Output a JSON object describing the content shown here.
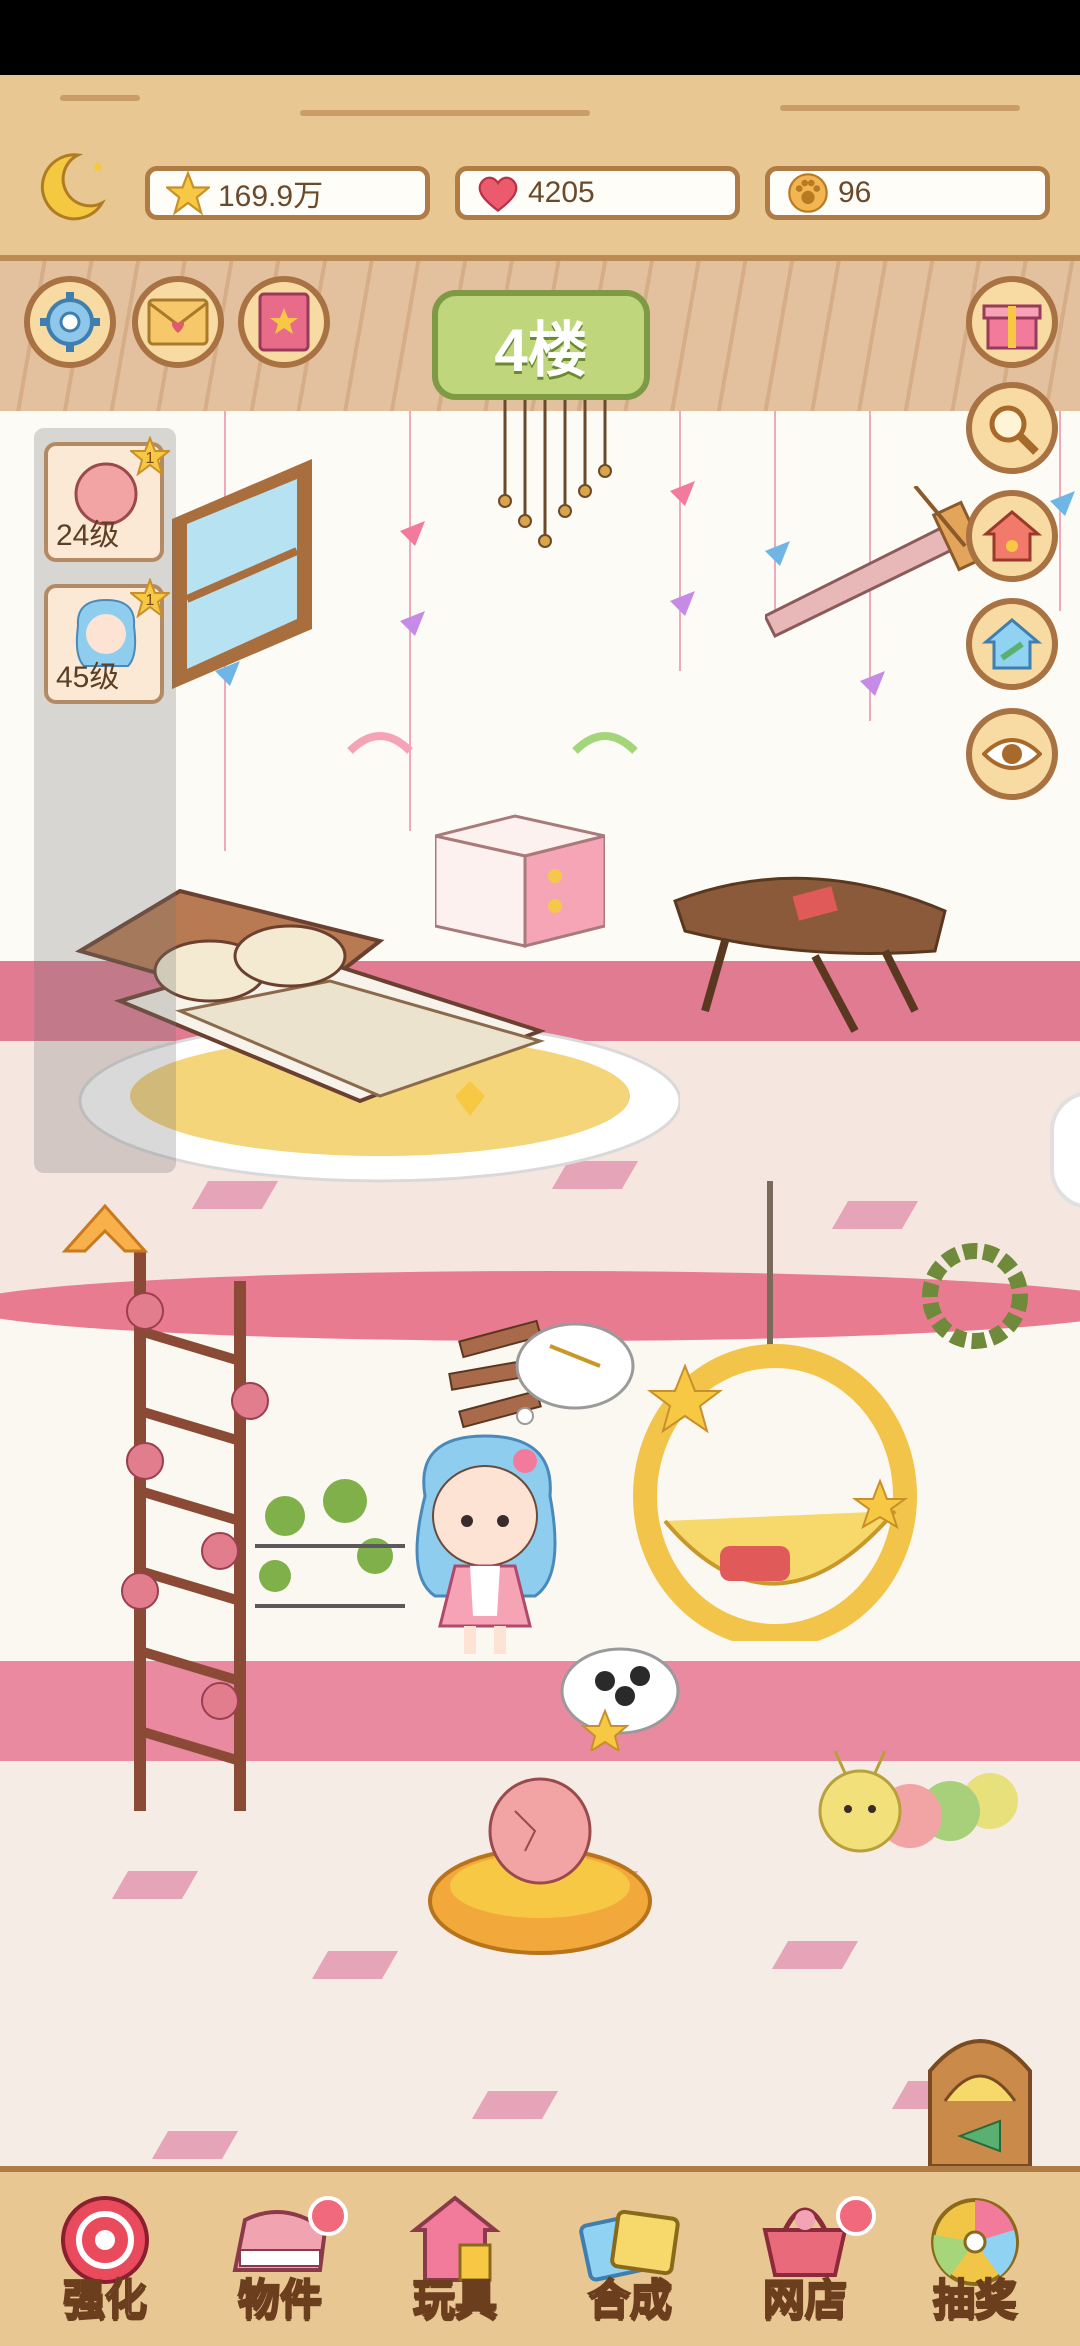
{
  "resources": [
    {
      "icon": "star-icon",
      "value": "169.9万"
    },
    {
      "icon": "heart-icon",
      "value": "4205"
    },
    {
      "icon": "paw-coin-icon",
      "value": "96"
    }
  ],
  "floor": {
    "label": "4楼"
  },
  "characters": [
    {
      "level": "24级",
      "badge": "1"
    },
    {
      "level": "45级",
      "badge": "1"
    }
  ],
  "nav": [
    {
      "label": "强化",
      "color": "#e94a5c"
    },
    {
      "label": "物件",
      "color": "#e9808f"
    },
    {
      "label": "玩具",
      "color": "#f2a36b"
    },
    {
      "label": "合成",
      "color": "#7cc2e6"
    },
    {
      "label": "网店",
      "color": "#e96b7b"
    },
    {
      "label": "抽奖",
      "color": "#f1c646"
    }
  ],
  "colors": {
    "wood": "#e9c792",
    "wall_pink": "#e07b92",
    "accent_green": "#bfd67d"
  }
}
